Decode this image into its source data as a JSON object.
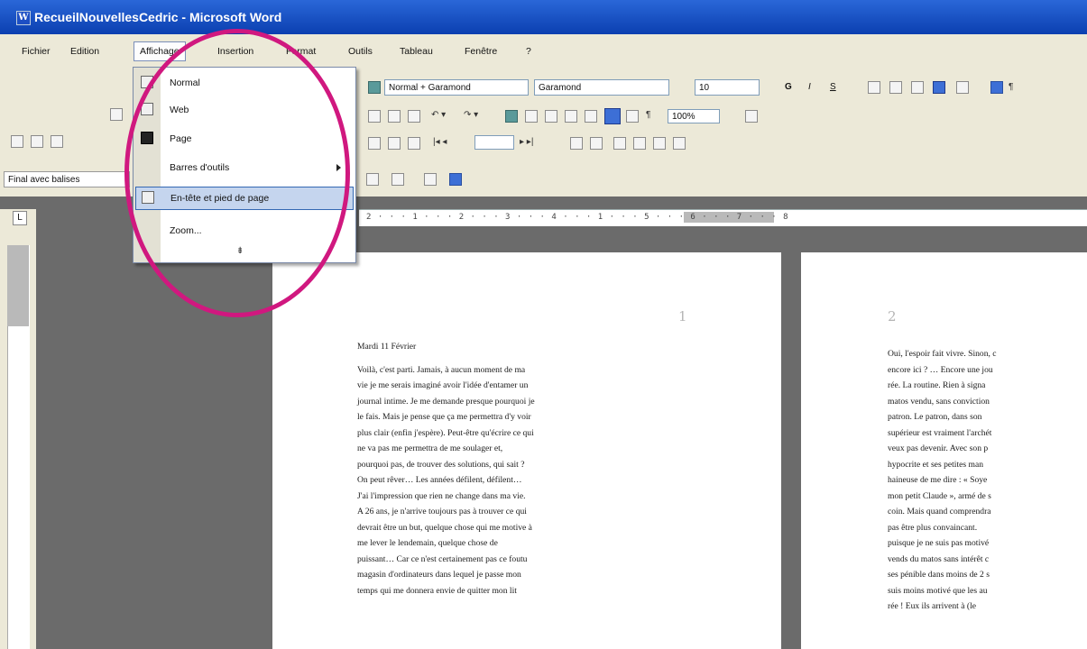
{
  "window": {
    "title": "RecueilNouvellesCedric - Microsoft Word",
    "title_icon": "word-doc-icon"
  },
  "menubar": {
    "items": [
      "Fichier",
      "Edition",
      "Affichage",
      "Insertion",
      "Format",
      "Outils",
      "Tableau",
      "Fenêtre",
      "?"
    ],
    "active": "Affichage"
  },
  "toolbar": {
    "style_combo": "Normal + Garamond",
    "font_combo": "Garamond",
    "size_combo": "10",
    "bold": "G",
    "italic": "I",
    "underline": "S",
    "zoom_combo": "100%",
    "review_combo": "Final avec balises"
  },
  "ruler": {
    "marks": "2 · · · 1 · · · 2 · · · 3 · · · 4 · · · 1 · · · 5 · · · 6 · · · 7 · · · 8"
  },
  "view_menu": {
    "items": [
      {
        "label": "Normal",
        "icon": "normal-view-icon"
      },
      {
        "label": "Web",
        "icon": "web-view-icon"
      },
      {
        "label": "Page",
        "icon": "page-view-icon"
      },
      {
        "label": "Barres d'outils",
        "icon": "",
        "submenu": true
      },
      {
        "label": "En-tête et pied de page",
        "icon": "header-footer-icon",
        "highlighted": true
      },
      {
        "label": "Zoom...",
        "icon": ""
      }
    ],
    "expand_glyph": "⇟"
  },
  "page1": {
    "page_number": "1",
    "date": "Mardi 11 Février",
    "lines": [
      "Voilà, c'est parti. Jamais, à aucun moment de ma",
      "vie je me serais imaginé avoir l'idée d'entamer un",
      "journal intime. Je me demande presque pourquoi je",
      "le fais. Mais je pense que ça me permettra d'y voir",
      "plus clair (enfin j'espère). Peut-être qu'écrire ce qui",
      "ne va pas me permettra de me soulager et,",
      "pourquoi pas, de trouver des solutions, qui sait ?",
      "On peut rêver… Les années défilent, défilent…",
      "J'ai l'impression que rien ne change dans ma vie.",
      "A 26 ans, je n'arrive toujours pas à trouver ce qui",
      "devrait être un but, quelque chose qui me motive à",
      "me lever le lendemain, quelque chose de",
      "puissant… Car ce n'est certainement pas ce foutu",
      "magasin d'ordinateurs dans lequel je passe mon",
      "temps qui me donnera envie de quitter mon lit"
    ]
  },
  "page2": {
    "page_number": "2",
    "lines": [
      "Oui, l'espoir fait vivre. Sinon, c",
      "encore ici ? … Encore une jou",
      "rée. La routine. Rien à signa",
      "matos vendu, sans conviction",
      "patron. Le patron, dans son",
      "supérieur est vraiment l'archét",
      "veux pas devenir. Avec son p",
      "hypocrite et ses petites man",
      "haineuse de me dire : « Soye",
      "mon petit Claude », armé de s",
      "coin. Mais quand comprendra",
      "pas être plus convaincant.",
      "puisque je ne suis pas motivé",
      "vends du matos sans intérêt c",
      "ses pénible dans moins de 2 s",
      "suis moins motivé que les au",
      "rée ! Eux ils arrivent à (le"
    ]
  }
}
